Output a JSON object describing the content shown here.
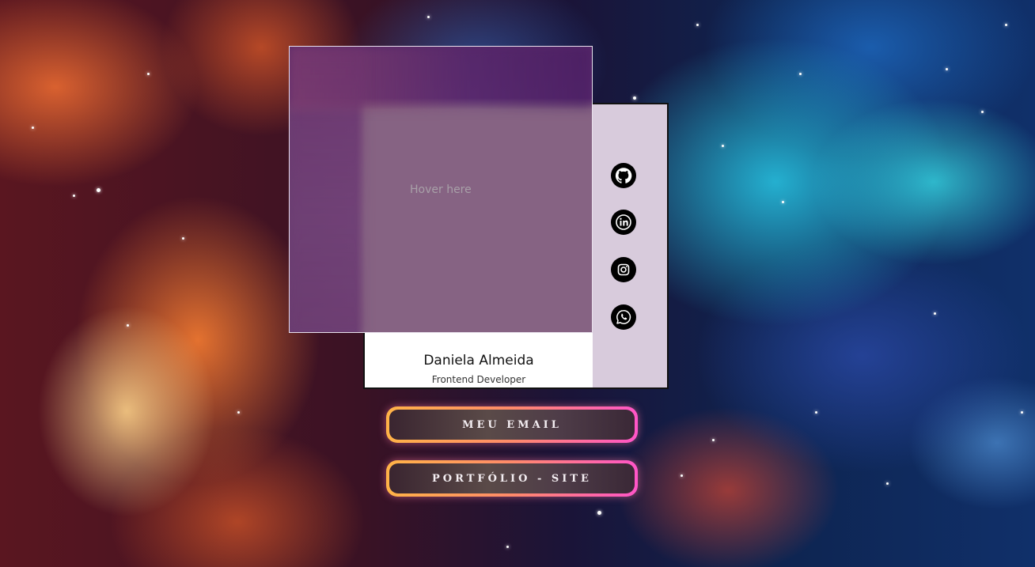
{
  "card": {
    "hover_hint": "Hover here",
    "name": "Daniela Almeida",
    "role": "Frontend Developer",
    "social": [
      {
        "icon": "github-icon"
      },
      {
        "icon": "linkedin-icon"
      },
      {
        "icon": "instagram-icon"
      },
      {
        "icon": "whatsapp-icon"
      }
    ]
  },
  "buttons": {
    "email_label": "MEU EMAIL",
    "portfolio_label": "PORTFÓLIO - SITE"
  },
  "colors": {
    "button_gradient_start": "#ffb347",
    "button_gradient_end": "#ff55c8",
    "social_panel": "#d8cbdc",
    "photo_overlay": "#866383"
  }
}
